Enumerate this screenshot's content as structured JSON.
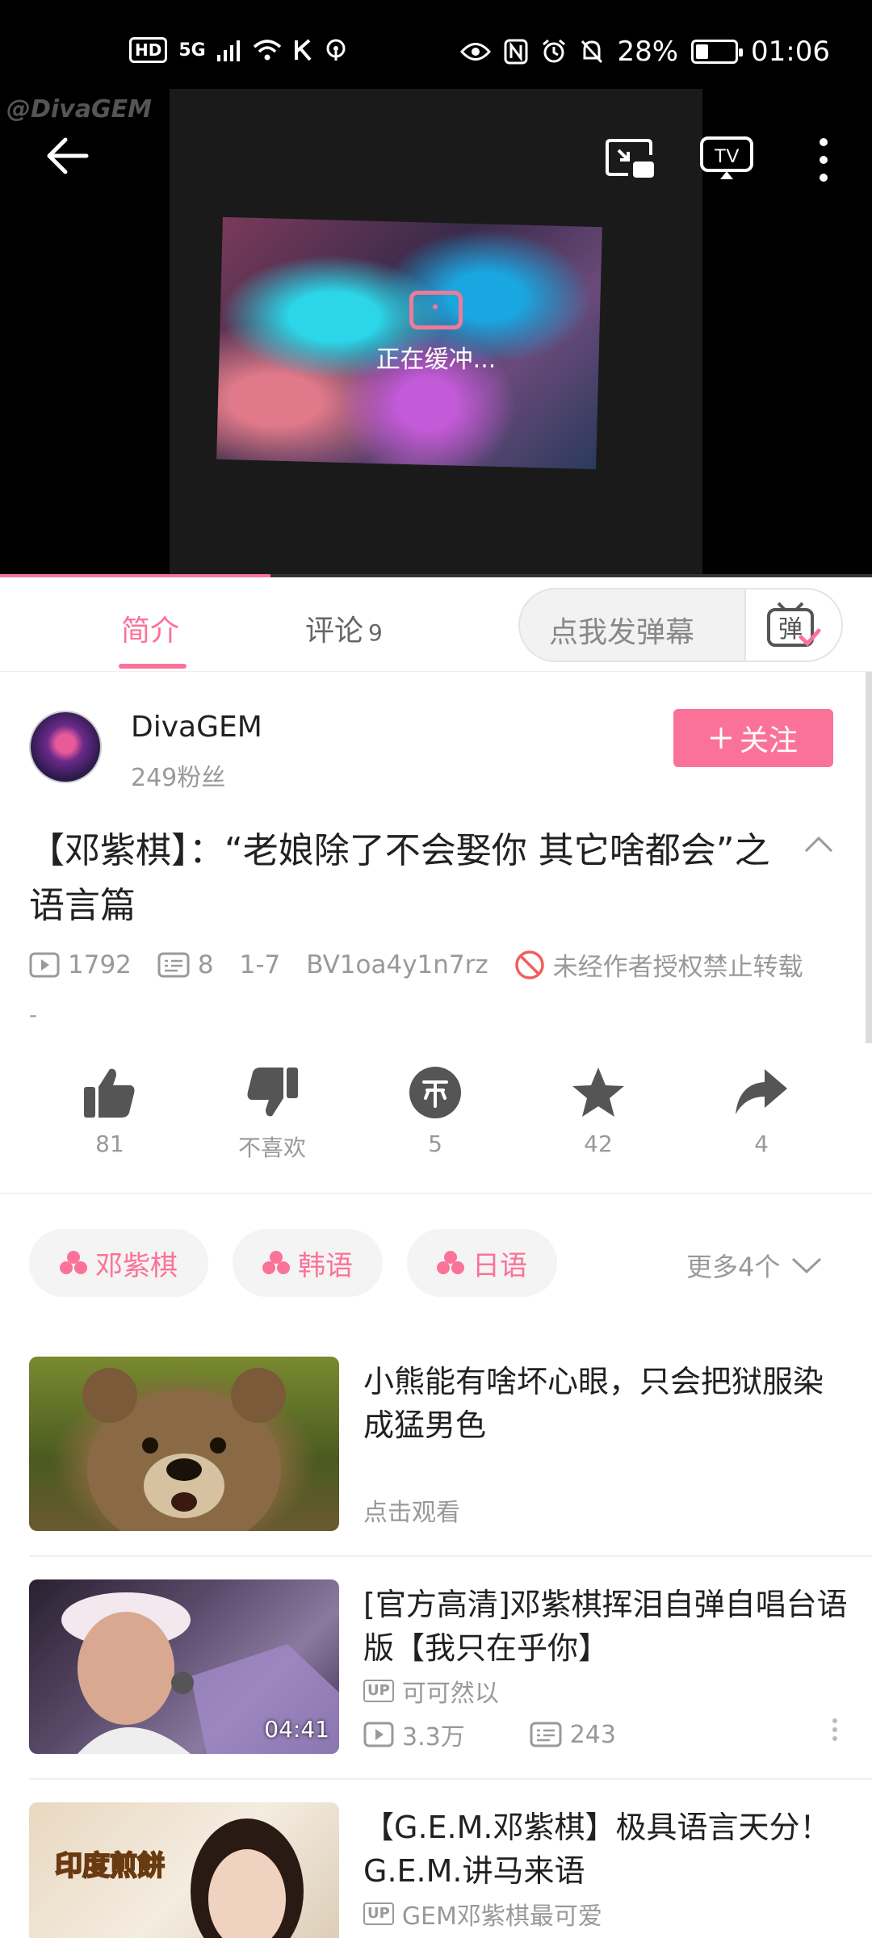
{
  "status_bar": {
    "net_badge": "HD",
    "net_type": "5G",
    "battery": "28%",
    "battery_fraction": 0.28,
    "time": "01:06"
  },
  "player": {
    "watermark": "@DivaGEM",
    "buffering_text": "正在缓冲...",
    "progress_fraction": 0.31,
    "icons": [
      "back-arrow-icon",
      "pip-icon",
      "cast-tv-icon",
      "more-vertical-icon"
    ]
  },
  "tabs": {
    "intro": "简介",
    "comments": "评论",
    "comments_count": "9",
    "danmu_placeholder": "点我发弹幕",
    "danmu_icon_char": "弹"
  },
  "uploader": {
    "name": "DivaGEM",
    "fans": "249粉丝",
    "follow_label": "关注"
  },
  "video": {
    "title": "【邓紫棋】：“老娘除了不会娶你 其它啥都会”之语言篇",
    "views": "1792",
    "danmaku": "8",
    "date": "1-7",
    "bvid": "BV1oa4y1n7rz",
    "no_repost": "未经作者授权禁止转载",
    "description": "-"
  },
  "actions": {
    "like": "81",
    "dislike": "不喜欢",
    "coin": "5",
    "favorite": "42",
    "share": "4"
  },
  "tags": {
    "items": [
      "邓紫棋",
      "韩语",
      "日语"
    ],
    "more": "更多4个"
  },
  "recommendations": [
    {
      "title": "小熊能有啥坏心眼，只会把狱服染成猛男色",
      "sub": "点击观看"
    },
    {
      "title": "[官方高清]邓紫棋挥泪自弹自唱台语版【我只在乎你】",
      "up_badge": "UP",
      "uploader": "可可然以",
      "views": "3.3万",
      "danmaku": "243",
      "duration": "04:41"
    },
    {
      "title": "【G.E.M.邓紫棋】极具语言天分！G.E.M.讲马来语",
      "up_badge": "UP",
      "uploader": "GEM邓紫棋最可爱",
      "thumb_caption": "印度煎餅"
    }
  ],
  "colors": {
    "accent": "#fb7299",
    "muted": "#999999",
    "text": "#212121"
  }
}
